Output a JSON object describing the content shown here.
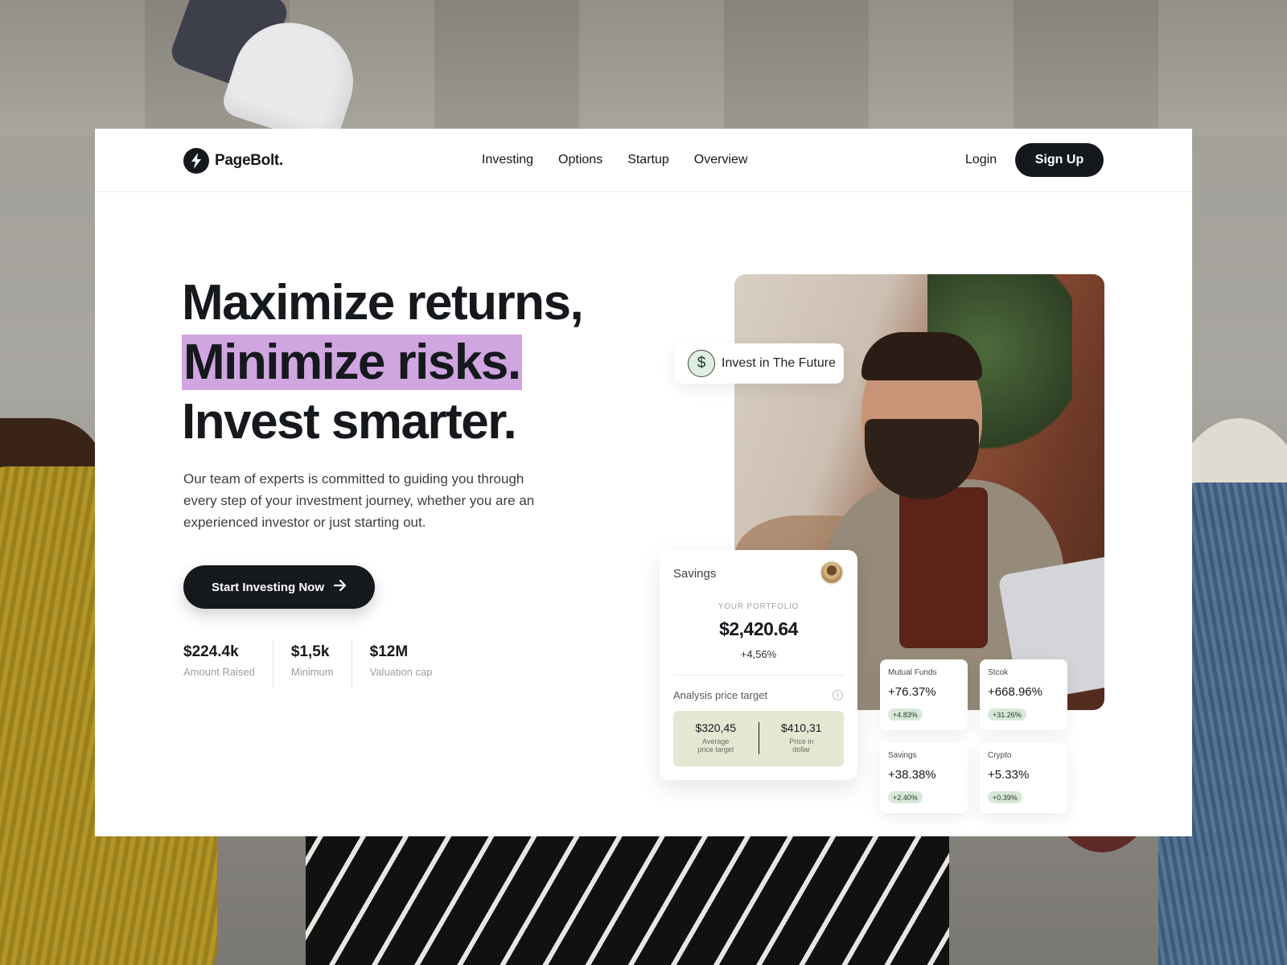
{
  "brand": {
    "name": "PageBolt.",
    "icon": "bolt-icon"
  },
  "nav": {
    "links": [
      "Investing",
      "Options",
      "Startup",
      "Overview"
    ],
    "login_label": "Login",
    "signup_label": "Sign Up"
  },
  "hero": {
    "line1": "Maximize returns,",
    "line2": "Minimize risks.",
    "line3": "Invest smarter.",
    "highlight_color": "#cfa6e0",
    "description": "Our team of experts is committed to guiding you through every step of your investment journey, whether you are an experienced investor or just starting out.",
    "cta_label": "Start Investing Now",
    "cta_icon": "arrow-right-icon"
  },
  "stats": [
    {
      "value": "$224.4k",
      "label": "Amount Raised"
    },
    {
      "value": "$1,5k",
      "label": "Minimum"
    },
    {
      "value": "$12M",
      "label": "Valuation cap"
    }
  ],
  "invest_pill": {
    "icon": "dollar-icon",
    "label": "Invest in The Future"
  },
  "savings_card": {
    "title": "Savings",
    "caption": "YOUR PORTFOLIO",
    "amount": "$2,420.64",
    "change": "+4,56%",
    "analysis_label": "Analysis price target",
    "average": {
      "value": "$320,45",
      "label_1": "Average",
      "label_2": "price target"
    },
    "price": {
      "value": "$410,31",
      "label_1": "Price in",
      "label_2": "dollar"
    }
  },
  "mini_cards": [
    {
      "label": "Mutual Funds",
      "value": "+76.37%",
      "badge": "+4.83%"
    },
    {
      "label": "Stcok",
      "value": "+668.96%",
      "badge": "+31.26%"
    },
    {
      "label": "Savings",
      "value": "+38.38%",
      "badge": "+2.40%"
    },
    {
      "label": "Crypto",
      "value": "+5.33%",
      "badge": "+0.39%"
    }
  ]
}
